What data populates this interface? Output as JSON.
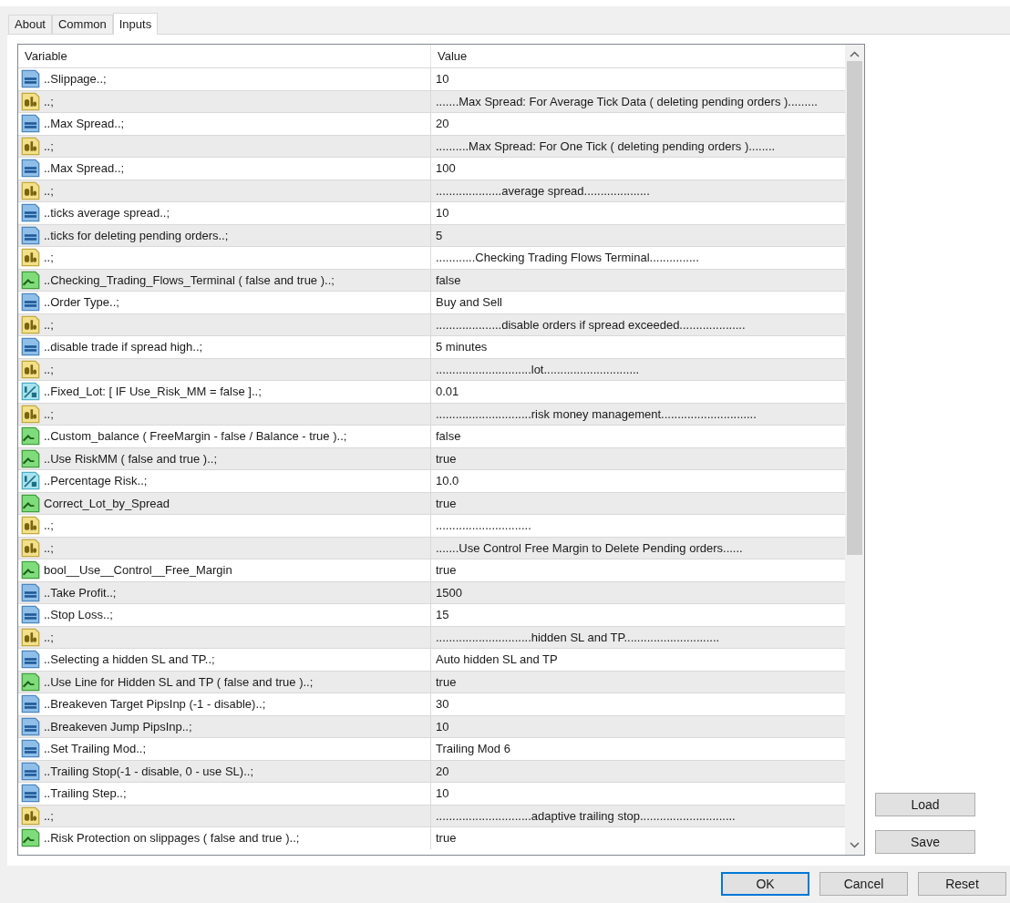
{
  "tabs": [
    {
      "label": "About",
      "selected": false
    },
    {
      "label": "Common",
      "selected": false
    },
    {
      "label": "Inputs",
      "selected": true
    }
  ],
  "table": {
    "columns": [
      "Variable",
      "Value"
    ],
    "rows": [
      {
        "kind": "int",
        "variable": "..Slippage..;",
        "value": "10"
      },
      {
        "kind": "string",
        "variable": "..;",
        "value": ".......Max Spread: For Average Tick Data ( deleting pending orders )........."
      },
      {
        "kind": "int",
        "variable": "..Max Spread..;",
        "value": "20"
      },
      {
        "kind": "string",
        "variable": "..;",
        "value": "..........Max Spread: For One Tick ( deleting pending orders )........"
      },
      {
        "kind": "int",
        "variable": "..Max Spread..;",
        "value": "100"
      },
      {
        "kind": "string",
        "variable": "..;",
        "value": "....................average spread...................."
      },
      {
        "kind": "int",
        "variable": "..ticks average spread..;",
        "value": "10"
      },
      {
        "kind": "int",
        "variable": "..ticks for deleting pending orders..;",
        "value": "5"
      },
      {
        "kind": "string",
        "variable": "..;",
        "value": "............Checking Trading Flows Terminal..............."
      },
      {
        "kind": "bool",
        "variable": "..Checking_Trading_Flows_Terminal ( false and true )..;",
        "value": "false"
      },
      {
        "kind": "int",
        "variable": "..Order Type..;",
        "value": "Buy and Sell"
      },
      {
        "kind": "string",
        "variable": "..;",
        "value": "....................disable orders if spread exceeded...................."
      },
      {
        "kind": "int",
        "variable": "..disable trade if spread high..;",
        "value": "5 minutes"
      },
      {
        "kind": "string",
        "variable": "..;",
        "value": ".............................lot............................."
      },
      {
        "kind": "double",
        "variable": "..Fixed_Lot: [ IF  Use_Risk_MM = false ]..;",
        "value": "0.01"
      },
      {
        "kind": "string",
        "variable": "..;",
        "value": ".............................risk money management............................."
      },
      {
        "kind": "bool",
        "variable": "..Custom_balance ( FreeMargin - false / Balance - true )..;",
        "value": "false"
      },
      {
        "kind": "bool",
        "variable": "..Use RiskMM ( false and true )..;",
        "value": "true"
      },
      {
        "kind": "double",
        "variable": "..Percentage Risk..;",
        "value": "10.0"
      },
      {
        "kind": "bool",
        "variable": "Correct_Lot_by_Spread",
        "value": "true"
      },
      {
        "kind": "string",
        "variable": "..;",
        "value": "............................."
      },
      {
        "kind": "string",
        "variable": "..;",
        "value": ".......Use Control Free Margin to Delete Pending orders......"
      },
      {
        "kind": "bool",
        "variable": "bool__Use__Control__Free_Margin",
        "value": "true"
      },
      {
        "kind": "int",
        "variable": "..Take Profit..;",
        "value": "1500"
      },
      {
        "kind": "int",
        "variable": "..Stop Loss..;",
        "value": "15"
      },
      {
        "kind": "string",
        "variable": "..;",
        "value": ".............................hidden SL and TP............................."
      },
      {
        "kind": "int",
        "variable": "..Selecting a hidden SL and TP..;",
        "value": "Auto hidden SL and TP"
      },
      {
        "kind": "bool",
        "variable": "..Use Line for Hidden SL and TP ( false and true )..;",
        "value": "true"
      },
      {
        "kind": "int",
        "variable": "..Breakeven Target PipsInp (-1 - disable)..;",
        "value": "30"
      },
      {
        "kind": "int",
        "variable": "..Breakeven Jump PipsInp..;",
        "value": "10"
      },
      {
        "kind": "int",
        "variable": "..Set Trailing Mod..;",
        "value": "Trailing Mod 6"
      },
      {
        "kind": "int",
        "variable": "..Trailing Stop(-1 - disable, 0 - use SL)..;",
        "value": "20"
      },
      {
        "kind": "int",
        "variable": "..Trailing Step..;",
        "value": "10"
      },
      {
        "kind": "string",
        "variable": "..;",
        "value": ".............................adaptive trailing stop............................."
      },
      {
        "kind": "bool",
        "variable": "..Risk Protection on slippages ( false and true )..;",
        "value": "true"
      }
    ]
  },
  "side_buttons": [
    "Load",
    "Save"
  ],
  "footer_buttons": [
    {
      "label": "OK",
      "default": true
    },
    {
      "label": "Cancel",
      "default": false
    },
    {
      "label": "Reset",
      "default": false
    }
  ]
}
